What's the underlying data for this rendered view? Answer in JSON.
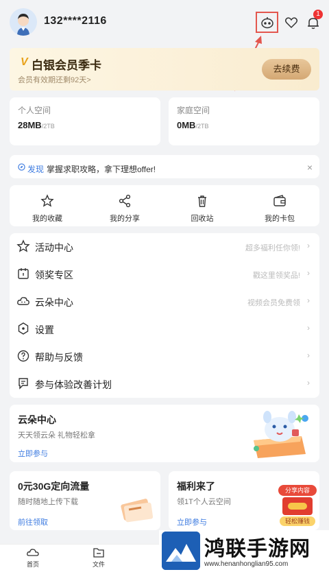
{
  "header": {
    "username": "132****2116",
    "notification_count": "1",
    "icons": [
      "robot-icon",
      "heart-icon",
      "bell-icon"
    ]
  },
  "vip": {
    "badge": "V",
    "title": "白银会员季卡",
    "subtitle": "会员有效期还剩92天>",
    "renew_label": "去续费"
  },
  "spaces": [
    {
      "label": "个人空间",
      "value": "28MB",
      "total": "/2TB"
    },
    {
      "label": "家庭空间",
      "value": "0MB",
      "total": "/2TB"
    }
  ],
  "notice": {
    "tag": "发现",
    "text": "掌握求职攻略，拿下理想offer!",
    "close": "×"
  },
  "quick_actions": [
    {
      "label": "我的收藏",
      "icon": "star-icon"
    },
    {
      "label": "我的分享",
      "icon": "share-icon"
    },
    {
      "label": "回收站",
      "icon": "trash-icon"
    },
    {
      "label": "我的卡包",
      "icon": "wallet-icon"
    }
  ],
  "menu": [
    {
      "label": "活动中心",
      "hint": "超多福利任你领!",
      "icon": "star-outline-icon"
    },
    {
      "label": "领奖专区",
      "hint": "戳这里领奖品!",
      "icon": "calendar-icon"
    },
    {
      "label": "云朵中心",
      "hint": "视频会员免费领",
      "icon": "cloud-icon"
    },
    {
      "label": "设置",
      "hint": "",
      "icon": "gear-icon"
    },
    {
      "label": "帮助与反馈",
      "hint": "",
      "icon": "help-icon"
    },
    {
      "label": "参与体验改善计划",
      "hint": "",
      "icon": "feedback-icon"
    }
  ],
  "cloud_center": {
    "title": "云朵中心",
    "subtitle": "天天领云朵 礼物轻松拿",
    "link": "立即参与"
  },
  "promo_left": {
    "title": "0元30G定向流量",
    "subtitle": "随时随地上传下载",
    "link": "前往领取"
  },
  "promo_right": {
    "title": "福利来了",
    "subtitle": "领1T个人云空间",
    "link": "立即参与",
    "tag_top": "分享内容",
    "tag_bottom": "轻松赚钱"
  },
  "bottom_nav": [
    {
      "label": "首页",
      "icon": "home-icon"
    },
    {
      "label": "文件",
      "icon": "file-icon"
    }
  ],
  "watermark": {
    "title": "鸿联手游网",
    "url": "www.henanhonglian95.com"
  },
  "colors": {
    "accent_blue": "#3d7be0",
    "vip_gold": "#d4a874",
    "highlight_red": "#e3564e"
  }
}
